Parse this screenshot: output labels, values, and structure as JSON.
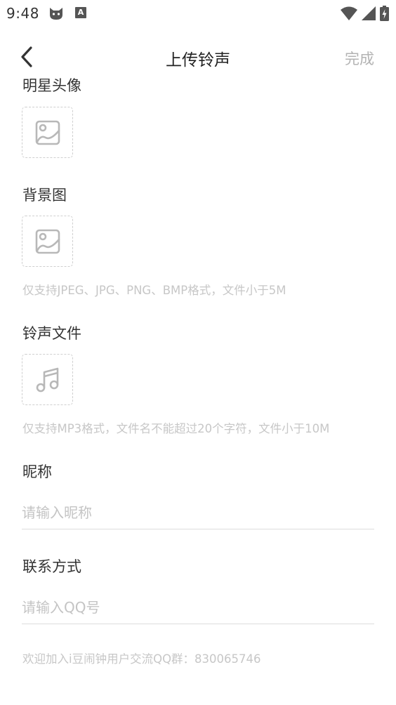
{
  "status_bar": {
    "time": "9:48",
    "notification_icons": [
      "cat-icon",
      "a-badge-icon"
    ],
    "a_badge": "A",
    "right_icons": [
      "wifi-icon",
      "signal-icon",
      "battery-icon"
    ]
  },
  "nav": {
    "back_icon": "chevron-left-icon",
    "title": "上传铃声",
    "done_label": "完成"
  },
  "sections": {
    "avatar": {
      "label": "明星头像",
      "icon": "image-icon"
    },
    "background": {
      "label": "背景图",
      "icon": "image-icon",
      "hint": "仅支持JPEG、JPG、PNG、BMP格式，文件小于5M"
    },
    "ringtone": {
      "label": "铃声文件",
      "icon": "music-note-icon",
      "hint": "仅支持MP3格式，文件名不能超过20个字符，文件小于10M"
    },
    "nickname": {
      "label": "昵称",
      "placeholder": "请输入昵称",
      "value": ""
    },
    "contact": {
      "label": "联系方式",
      "placeholder": "请输入QQ号",
      "value": ""
    }
  },
  "footer": {
    "qq_group_text": "欢迎加入i豆闹钟用户交流QQ群：830065746"
  },
  "colors": {
    "text": "#333333",
    "hint": "#c7c7c7",
    "done": "#b3b3b3",
    "divider": "#dcdcdc",
    "dashed_border": "#cfcfcf",
    "icon": "#b8b8b8"
  }
}
